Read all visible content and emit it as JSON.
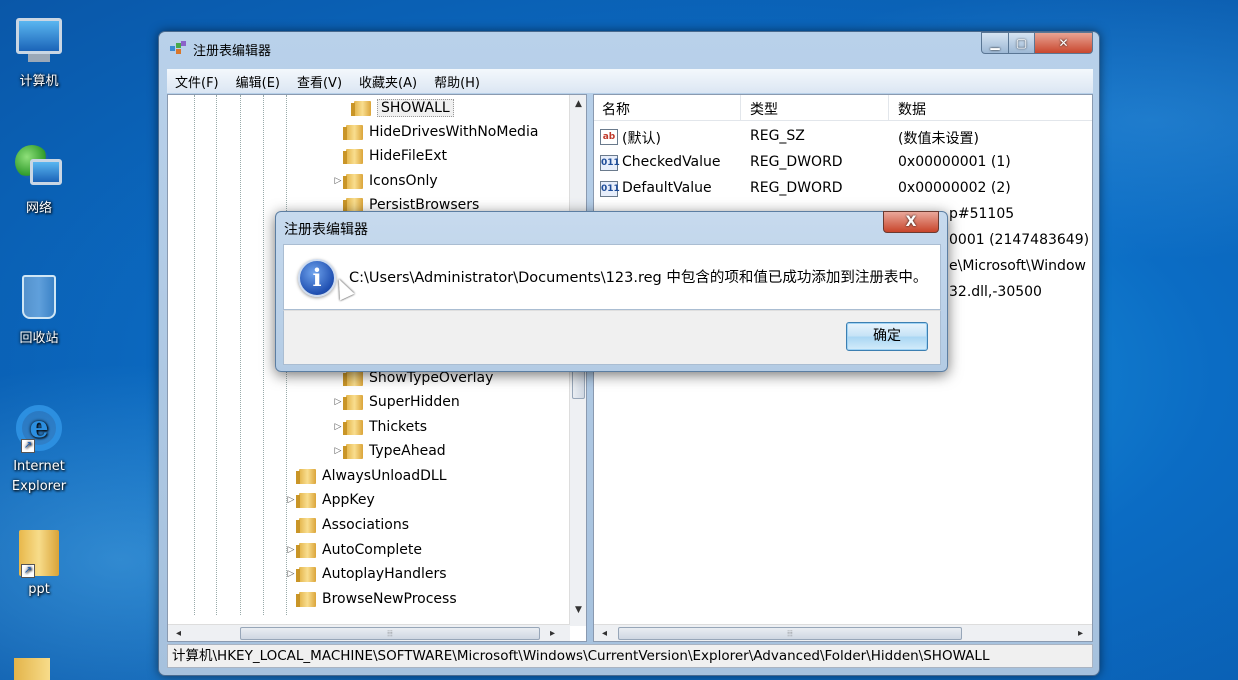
{
  "desktop": {
    "icons": [
      {
        "label": "计算机",
        "icon": "computer-icon"
      },
      {
        "label": "网络",
        "icon": "network-icon"
      },
      {
        "label": "回收站",
        "icon": "recycle-bin-icon"
      },
      {
        "label": "Internet Explorer",
        "icon": "internet-explorer-icon"
      },
      {
        "label": "ppt",
        "icon": "folder-icon"
      }
    ]
  },
  "window": {
    "title": "注册表编辑器",
    "menu": [
      "文件(F)",
      "编辑(E)",
      "查看(V)",
      "收藏夹(A)",
      "帮助(H)"
    ],
    "tree": {
      "nodes": [
        {
          "label": "SHOWALL",
          "selected": true,
          "expander": ""
        },
        {
          "label": "HideDrivesWithNoMedia",
          "expander": ""
        },
        {
          "label": "HideFileExt",
          "expander": ""
        },
        {
          "label": "IconsOnly",
          "expander": "▷"
        },
        {
          "label": "PersistBrowsers",
          "expander": ""
        },
        {
          "label": "ShowTypeOverlay",
          "expander": ""
        },
        {
          "label": "SuperHidden",
          "expander": "▷"
        },
        {
          "label": "Thickets",
          "expander": "▷"
        },
        {
          "label": "TypeAhead",
          "expander": "▷"
        },
        {
          "label": "AlwaysUnloadDLL",
          "expander": ""
        },
        {
          "label": "AppKey",
          "expander": "▷"
        },
        {
          "label": "Associations",
          "expander": ""
        },
        {
          "label": "AutoComplete",
          "expander": "▷"
        },
        {
          "label": "AutoplayHandlers",
          "expander": "▷"
        },
        {
          "label": "BrowseNewProcess",
          "expander": ""
        }
      ]
    },
    "values": {
      "columns": [
        "名称",
        "类型",
        "数据"
      ],
      "rows": [
        {
          "icon": "ab",
          "name": "(默认)",
          "type": "REG_SZ",
          "data": "(数值未设置)"
        },
        {
          "icon": "011",
          "name": "CheckedValue",
          "type": "REG_DWORD",
          "data": "0x00000001 (1)"
        },
        {
          "icon": "011",
          "name": "DefaultValue",
          "type": "REG_DWORD",
          "data": "0x00000002 (2)"
        },
        {
          "data": "p#51105"
        },
        {
          "data": "0001 (2147483649)"
        },
        {
          "data": "e\\Microsoft\\Window"
        },
        {
          "data": "32.dll,-30500"
        }
      ]
    },
    "status_path": "计算机\\HKEY_LOCAL_MACHINE\\SOFTWARE\\Microsoft\\Windows\\CurrentVersion\\Explorer\\Advanced\\Folder\\Hidden\\SHOWALL"
  },
  "dialog": {
    "title": "注册表编辑器",
    "close_label": "X",
    "icon": "info-icon",
    "message": "C:\\Users\\Administrator\\Documents\\123.reg 中包含的项和值已成功添加到注册表中。",
    "ok_label": "确定"
  }
}
